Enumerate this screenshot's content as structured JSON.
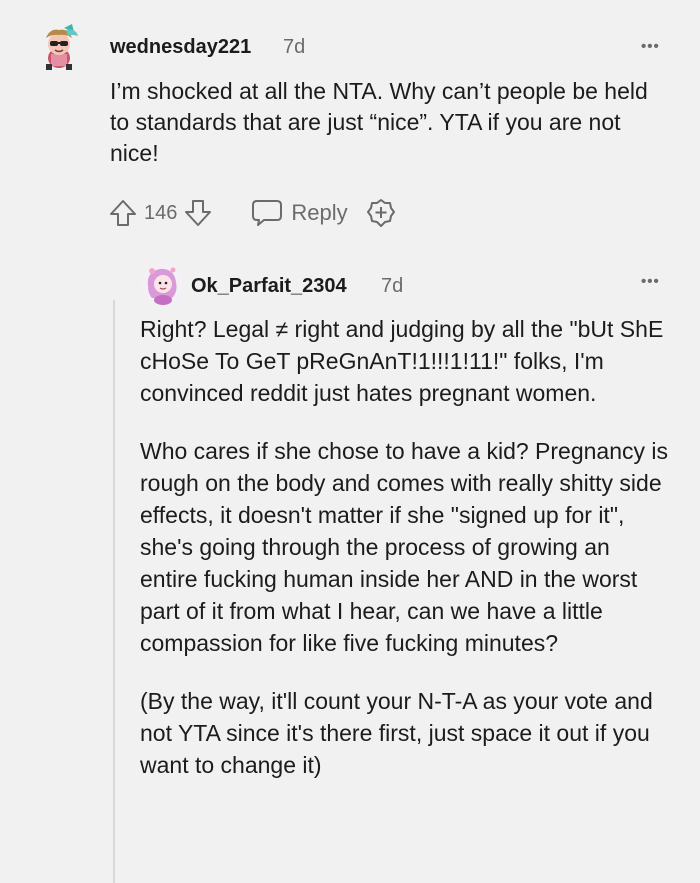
{
  "comment": {
    "username": "wednesday221",
    "time": "7d",
    "more": "•••",
    "text": "I’m shocked at all the NTA. Why can’t people be held to standards that are just “nice”. YTA if you are not nice!",
    "upvotes": "146",
    "reply_label": "Reply"
  },
  "reply": {
    "username": "Ok_Parfait_2304",
    "time": "7d",
    "more": "•••",
    "paragraphs": [
      "Right? Legal ≠ right and judging by all the \"bUt ShE cHoSe To GeT pReGnAnT!1!!!1!11!\" folks, I'm convinced reddit just hates pregnant women.",
      "Who cares if she chose to have a kid? Pregnancy is rough on the body and comes with really shitty side effects, it doesn't matter if she \"signed up for it\", she's going through the process of growing an entire fucking human inside her AND in the worst part of it from what I hear, can we have a little compassion for like five fucking minutes?",
      "(By the way, it'll count your N-T-A as your vote and not YTA since it's there first, just space it out if you want to change it)"
    ]
  },
  "colors": {
    "background": "#f1f1f1",
    "text": "#1c1c1c",
    "meta": "#6b6b6b",
    "thread_line": "#d8d8d8"
  },
  "icons": [
    "avatar",
    "more-icon",
    "upvote-icon",
    "downvote-icon",
    "reply-icon",
    "award-icon"
  ]
}
